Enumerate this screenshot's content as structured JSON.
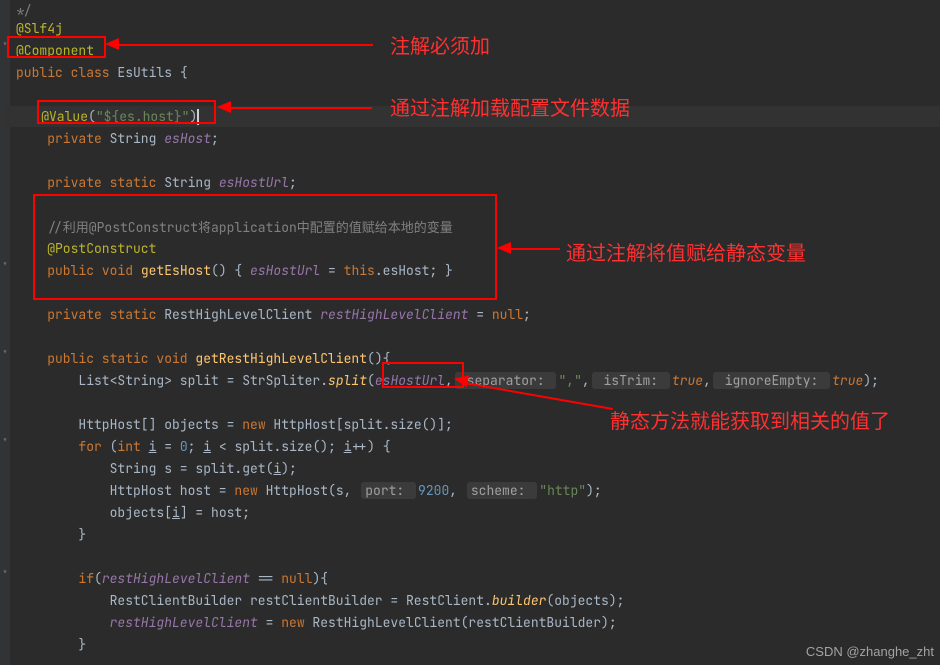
{
  "callouts": {
    "c1": "注解必须加",
    "c2": "通过注解加载配置文件数据",
    "c3": "通过注解将值赋给静态变量",
    "c4": "静态方法就能获取到相关的值了"
  },
  "code": {
    "l1": "*/",
    "l2_ann": "@Slf4j",
    "l3_ann": "@Component",
    "l4_kw1": "public class ",
    "l4_cls": "EsUtils ",
    "l5": "",
    "l6_ann": "@Value",
    "l6_p1": "(",
    "l6_str": "\"${es.host}\"",
    "l6_p2": ")",
    "l7_kw": "private ",
    "l7_type": "String ",
    "l7_var": "esHost",
    "l7_semi": ";",
    "l8": "",
    "l9_kw": "private static ",
    "l9_type": "String ",
    "l9_var": "esHostUrl",
    "l9_semi": ";",
    "l10": "",
    "l11_cmt": "//利用@PostConstruct将application中配置的值赋给本地的变量",
    "l12_ann": "@PostConstruct",
    "l13_kw": "public void ",
    "l13_fn": "getEsHost",
    "l13_sig": "() { ",
    "l13_lhs": "esHostUrl",
    "l13_eq": " = ",
    "l13_this": "this",
    "l13_dot": ".esHost",
    "l13_semi": "; }",
    "l14": "",
    "l15_kw": "private static ",
    "l15_type": "RestHighLevelClient ",
    "l15_var": "restHighLevelClient",
    "l15_eq": " = ",
    "l15_null": "null",
    "l15_semi": ";",
    "l16": "",
    "l17_kw": "public static void ",
    "l17_fn": "getRestHighLevelClient",
    "l17_sig": "(){",
    "l18_1": "List<String> split = StrSpliter.",
    "l18_fn": "split",
    "l18_p1": "(",
    "l18_hl": "esHostUrl",
    "l18_c1": ",",
    "l18_h1": " separator: ",
    "l18_s1": "\",\"",
    "l18_c2": ",",
    "l18_h2": " isTrim: ",
    "l18_b1": "true",
    "l18_c3": ",",
    "l18_h3": " ignoreEmpty: ",
    "l18_b2": "true",
    "l18_p2": ");",
    "l19": "",
    "l20_1": "HttpHost[] objects = ",
    "l20_new": "new ",
    "l20_2": "HttpHost[split.size()];",
    "l21_for": "for ",
    "l21_p1": "(",
    "l21_int": "int ",
    "l21_i1": "i",
    "l21_eq": " = ",
    "l21_z": "0",
    "l21_sc1": "; ",
    "l21_i2": "i",
    "l21_lt": " < split.size(); ",
    "l21_i3": "i",
    "l21_inc": "++) {",
    "l22_1": "String s = split.get(",
    "l22_i": "i",
    "l22_2": ");",
    "l23_1": "HttpHost host = ",
    "l23_new": "new ",
    "l23_2": "HttpHost(s, ",
    "l23_h1": "port: ",
    "l23_port": "9200",
    "l23_c": ", ",
    "l23_h2": "scheme: ",
    "l23_scheme": "\"http\"",
    "l23_p": ");",
    "l24_1": "objects[",
    "l24_i": "i",
    "l24_2": "] = host;",
    "l25": "}",
    "l26": "",
    "l27_if": "if",
    "l27_p1": "(",
    "l27_v": "restHighLevelClient",
    "l27_eq": " == ",
    "l27_null": "null",
    "l27_p2": "){",
    "l28_1": "RestClientBuilder restClientBuilder = RestClient.",
    "l28_fn": "builder",
    "l28_2": "(objects);",
    "l29_v": "restHighLevelClient",
    "l29_eq": " = ",
    "l29_new": "new ",
    "l29_2": "RestHighLevelClient(restClientBuilder);",
    "l30": "}"
  },
  "watermark": "CSDN @zhanghe_zht"
}
